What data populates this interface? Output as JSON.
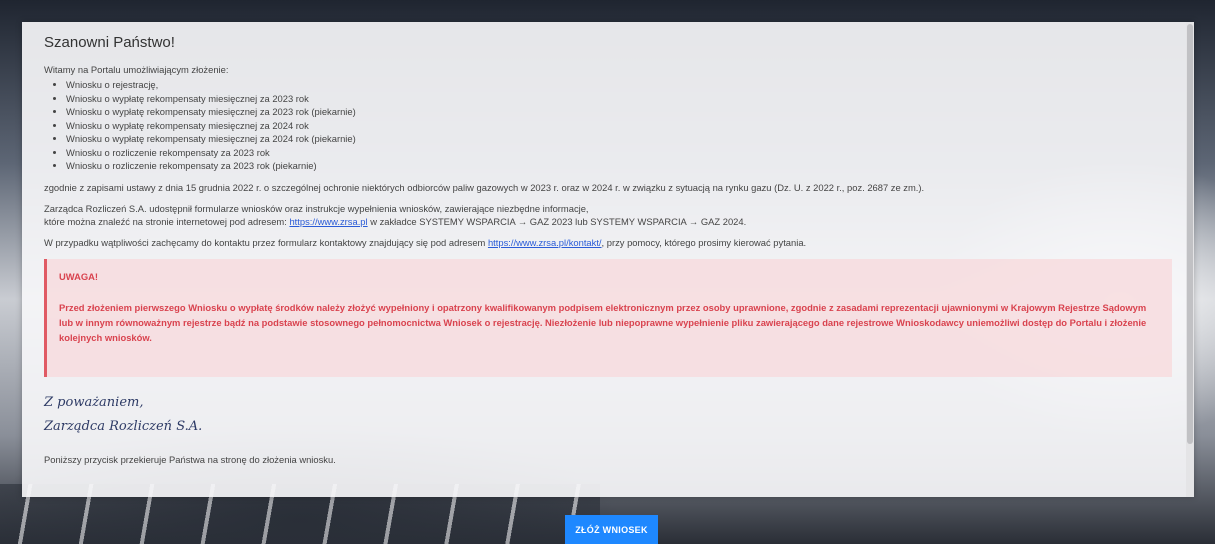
{
  "header": {
    "title": "Szanowni Państwo!"
  },
  "intro": "Witamy na Portalu umożliwiającym złożenie:",
  "list": [
    "Wniosku o rejestrację,",
    "Wniosku o wypłatę rekompensaty miesięcznej za 2023 rok",
    "Wniosku o wypłatę rekompensaty miesięcznej za 2023 rok (piekarnie)",
    "Wniosku o wypłatę rekompensaty miesięcznej za 2024 rok",
    "Wniosku o wypłatę rekompensaty miesięcznej za 2024 rok (piekarnie)",
    "Wniosku o rozliczenie rekompensaty za 2023 rok",
    "Wniosku o rozliczenie rekompensaty za 2023 rok (piekarnie)"
  ],
  "law": "zgodnie z zapisami ustawy z dnia 15 grudnia 2022 r. o szczególnej ochronie niektórych odbiorców paliw gazowych w 2023 r. oraz w 2024 r. w związku z sytuacją na rynku gazu (Dz. U. z 2022 r., poz. 2687 ze zm.).",
  "forms": {
    "line1": "Zarządca Rozliczeń S.A. udostępnił formularze wniosków oraz instrukcje wypełnienia wniosków, zawierające niezbędne informacje,",
    "line2_pre": "które można znaleźć na stronie internetowej pod adresem: ",
    "link": "https://www.zrsa.pl",
    "line2_post": " w zakładce SYSTEMY WSPARCIA → GAZ 2023 lub SYSTEMY WSPARCIA → GAZ 2024."
  },
  "contact": {
    "pre": "W przypadku wątpliwości zachęcamy do kontaktu przez formularz kontaktowy znajdujący się pod adresem ",
    "link": "https://www.zrsa.pl/kontakt/",
    "post": ", przy pomocy, którego prosimy kierować pytania."
  },
  "warning": {
    "title": "UWAGA!",
    "text": "Przed złożeniem pierwszego Wniosku o wypłatę środków należy złożyć wypełniony i opatrzony kwalifikowanym podpisem elektronicznym przez osoby uprawnione, zgodnie z zasadami reprezentacji ujawnionymi w Krajowym Rejestrze Sądowym lub w innym równoważnym rejestrze bądź na podstawie stosownego pełnomocnictwa Wniosek o rejestrację. Niezłożenie lub niepoprawne wypełnienie pliku zawierającego dane rejestrowe Wnioskodawcy uniemożliwi dostęp do Portalu i złożenie kolejnych wniosków."
  },
  "signature": {
    "line1": "Z poważaniem,",
    "line2": "Zarządca Rozliczeń S.A."
  },
  "note": "Poniższy przycisk przekieruje Państwa na stronę do złożenia wniosku.",
  "button": {
    "label": "ZŁÓŻ WNIOSEK"
  },
  "colors": {
    "accent": "#1e88ff",
    "warning": "#d9434f",
    "link": "#2a5bd7"
  }
}
